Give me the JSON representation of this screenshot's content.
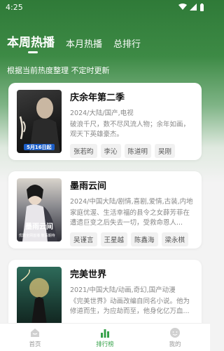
{
  "status_bar": {
    "time": "4:25"
  },
  "tabs": [
    {
      "label": "本周热播",
      "active": true
    },
    {
      "label": "本月热播",
      "active": false
    },
    {
      "label": "总排行",
      "active": false
    }
  ],
  "subtitle": "根据当前热度整理 不定时更新",
  "cards": [
    {
      "title": "庆余年第二季",
      "meta": "2024/大陆/国产,电视",
      "desc": "破浪千尺，数不尽风流人物；余年如画，观天下英雄豪杰。",
      "actors": [
        "张若昀",
        "李沁",
        "陈道明",
        "吴刚"
      ],
      "poster_date": "5月16日起"
    },
    {
      "title": "墨雨云间",
      "meta": "2024/中国大陆/剧情,喜剧,爱情,古装,内地",
      "desc": "家庭优渥、生活幸福的县令之女薛芳菲在遭遗巨变之后失去一切，受救命恩人...",
      "actors": [
        "吴谨言",
        "王星越",
        "陈鑫海",
        "梁永棋"
      ],
      "poster_title": "墨雨云间",
      "poster_caption": "优酷全网首播 敬请期待"
    },
    {
      "title": "完美世界",
      "meta": "2021/中国大陆/动画,奇幻,国产动漫",
      "desc": "《完美世界》动画改编自同名小说。他为修道而生，为应劫而至，他身化亿万血...",
      "actors": []
    }
  ],
  "bottom_nav": [
    {
      "label": "首页",
      "icon": "home-icon",
      "active": false
    },
    {
      "label": "排行榜",
      "icon": "chart-icon",
      "active": true
    },
    {
      "label": "我的",
      "icon": "profile-icon",
      "active": false
    }
  ],
  "colors": {
    "accent": "#36a24a",
    "header_green": "#2f7a38"
  }
}
